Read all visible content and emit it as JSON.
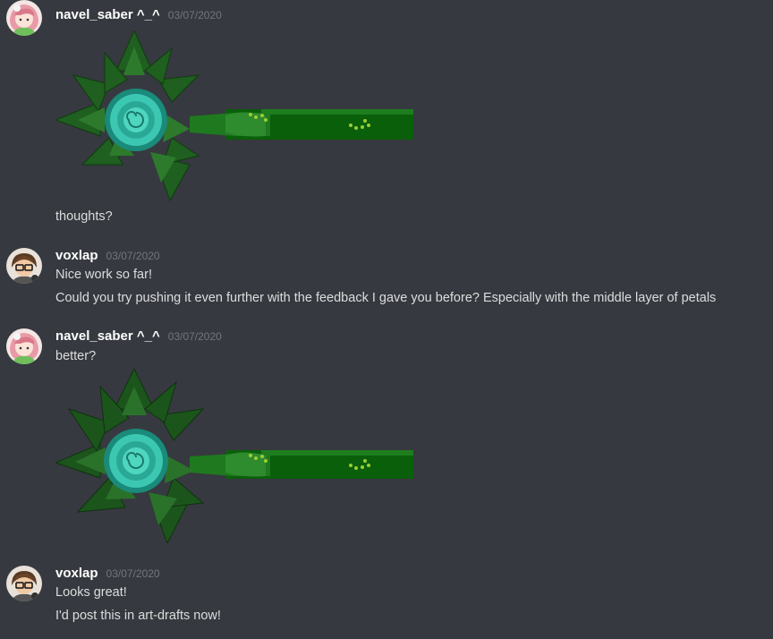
{
  "messages": [
    {
      "author": "navel_saber ^_^",
      "timestamp": "03/07/2020",
      "avatar": "navel-saber-avatar",
      "attachment": "rose-sword-drawing-v1",
      "lines": [
        "thoughts?"
      ]
    },
    {
      "author": "voxlap",
      "timestamp": "03/07/2020",
      "avatar": "voxlap-avatar",
      "lines": [
        "Nice work so far!",
        "Could you try pushing it even further with the feedback I gave you before? Especially with the middle layer of petals"
      ]
    },
    {
      "author": "navel_saber ^_^",
      "timestamp": "03/07/2020",
      "avatar": "navel-saber-avatar",
      "lines": [
        "better?"
      ],
      "attachment": "rose-sword-drawing-v2"
    },
    {
      "author": "voxlap",
      "timestamp": "03/07/2020",
      "avatar": "voxlap-avatar",
      "lines": [
        "Looks great!",
        "I'd post this in art-drafts now!"
      ]
    }
  ],
  "colors": {
    "background": "#36393f",
    "username": "#ffffff",
    "timestamp": "#72767d",
    "text": "#dcddde"
  }
}
